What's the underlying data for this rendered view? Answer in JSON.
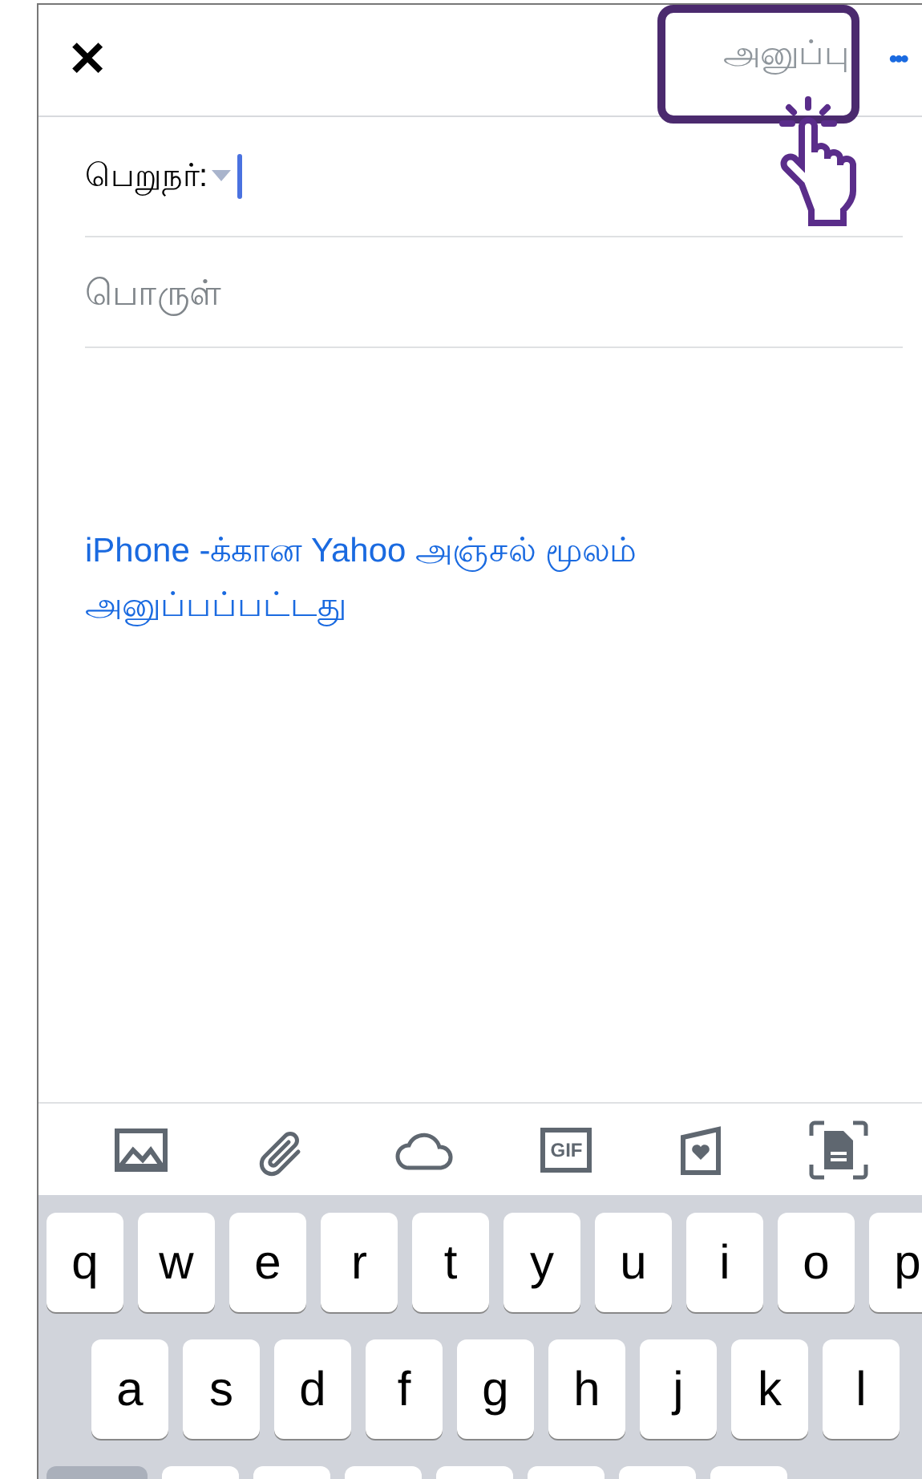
{
  "header": {
    "close": "✕",
    "send": {
      "label": "அனுப்பு",
      "disabled": true
    },
    "more": "•••"
  },
  "recipient": {
    "label": "பெறுநர்:"
  },
  "subject": {
    "placeholder": "பொருள்"
  },
  "signature": "iPhone -க்கான Yahoo அஞ்சல் மூலம் அனுப்பப்பட்டது",
  "toolbar": [
    {
      "kind": "photo"
    },
    {
      "kind": "attach"
    },
    {
      "kind": "cloud"
    },
    {
      "kind": "gif",
      "label": "GIF"
    },
    {
      "kind": "card"
    },
    {
      "kind": "scan"
    }
  ],
  "keyboard": {
    "rows": [
      [
        "q",
        "w",
        "e",
        "r",
        "t",
        "y",
        "u",
        "i",
        "o",
        "p"
      ],
      [
        "a",
        "s",
        "d",
        "f",
        "g",
        "h",
        "j",
        "k",
        "l"
      ]
    ]
  }
}
